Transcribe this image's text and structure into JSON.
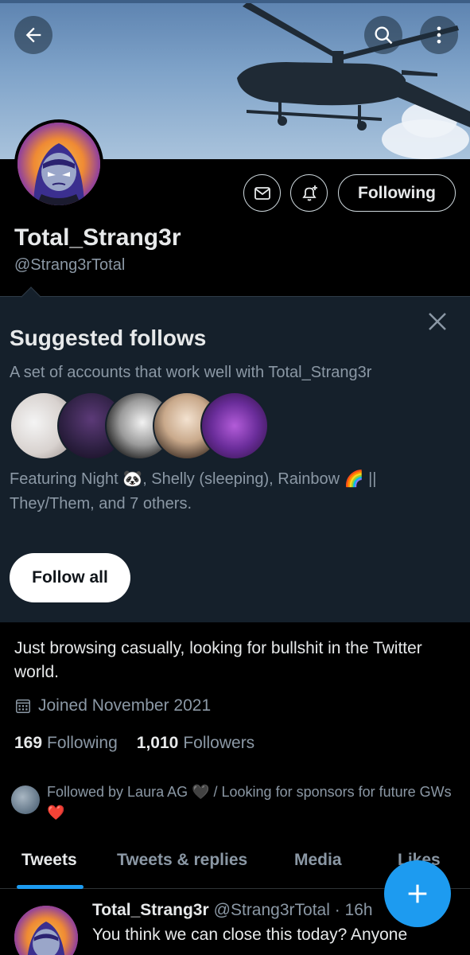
{
  "header": {
    "back_icon": "arrow-left-icon",
    "search_icon": "search-icon",
    "more_icon": "more-vertical-icon"
  },
  "profile": {
    "display_name": "Total_Strang3r",
    "handle": "@Strang3rTotal",
    "message_icon": "envelope-icon",
    "notify_icon": "bell-plus-icon",
    "following_label": "Following",
    "bio": "Just browsing casually, looking for bullshit in the Twitter world.",
    "joined_icon": "calendar-icon",
    "joined": "Joined November 2021",
    "following_count": "169",
    "following_label_stat": "Following",
    "followers_count": "1,010",
    "followers_label_stat": "Followers",
    "followed_by": "Followed by Laura AG 🖤 / Looking for sponsors for future GWs❤️"
  },
  "suggested": {
    "title": "Suggested follows",
    "description": "A set of accounts that work well with Total_Strang3r",
    "featuring": "Featuring Night 🐼, Shelly (sleeping), Rainbow 🌈 || They/Them, and 7 others.",
    "follow_all_label": "Follow all",
    "close_icon": "close-icon"
  },
  "tabs": [
    {
      "label": "Tweets",
      "active": true
    },
    {
      "label": "Tweets & replies",
      "active": false
    },
    {
      "label": "Media",
      "active": false
    },
    {
      "label": "Likes",
      "active": false
    }
  ],
  "tweet": {
    "name": "Total_Strang3r",
    "handle_time": "@Strang3rTotal · 16h",
    "text": "You think we can close this today? Anyone"
  },
  "fab": {
    "icon": "plus-icon"
  },
  "colors": {
    "accent": "#1d9bf0",
    "background": "#000000",
    "card": "#15202b",
    "muted_text": "#8b98a5"
  }
}
